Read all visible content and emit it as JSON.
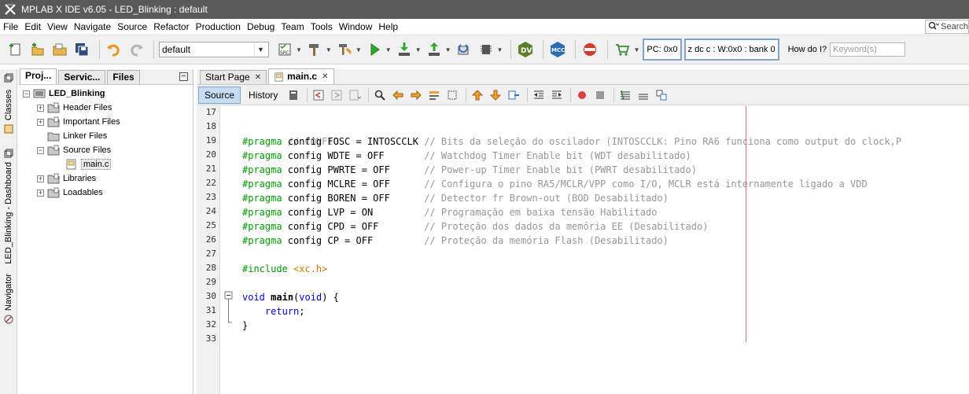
{
  "window": {
    "title": "MPLAB X IDE v6.05 - LED_Blinking : default"
  },
  "menu": [
    "File",
    "Edit",
    "View",
    "Navigate",
    "Source",
    "Refactor",
    "Production",
    "Debug",
    "Team",
    "Tools",
    "Window",
    "Help"
  ],
  "search": {
    "placeholder": "Search"
  },
  "toolbar": {
    "configuration": "default",
    "pc": "PC: 0x0",
    "status": "z dc c  : W:0x0 : bank 0",
    "howdoi_label": "How do I?",
    "keyword_placeholder": "Keyword(s)",
    "dv_label": "DV",
    "mcc_label": "MCC"
  },
  "left_strip": {
    "classes": "Classes",
    "dashboard": "LED_Blinking - Dashboard",
    "navigator": "Navigator"
  },
  "projects": {
    "tabs": [
      "Proj...",
      "Servic...",
      "Files"
    ],
    "root": "LED_Blinking",
    "folders": [
      "Header Files",
      "Important Files",
      "Linker Files",
      "Source Files",
      "Libraries",
      "Loadables"
    ],
    "source_file": "main.c"
  },
  "editor": {
    "tabs": [
      "Start Page",
      "main.c"
    ],
    "view_tabs": [
      "Source",
      "History"
    ],
    "line_numbers": [
      "17",
      "18",
      "19",
      "20",
      "21",
      "22",
      "23",
      "24",
      "25",
      "26",
      "27",
      "28",
      "29",
      "30",
      "31",
      "32",
      "33"
    ],
    "code": {
      "l18": "// CONFIG",
      "l19_pp": "#pragma",
      "l19_body": " config FOSC = INTOSCCLK ",
      "l19_comment": "// Bits da seleção do oscilador (INTOSCCLK: Pino RA6 funciona como output do clock,P",
      "l20_pp": "#pragma",
      "l20_body": " config WDTE = OFF       ",
      "l20_comment": "// Watchdog Timer Enable bit (WDT desabilitado)",
      "l21_pp": "#pragma",
      "l21_body": " config PWRTE = OFF      ",
      "l21_comment": "// Power-up Timer Enable bit (PWRT desabilitado)",
      "l22_pp": "#pragma",
      "l22_body": " config MCLRE = OFF      ",
      "l22_comment": "// Configura o pino RA5/MCLR/VPP como I/O, MCLR está internamente ligado a VDD",
      "l23_pp": "#pragma",
      "l23_body": " config BOREN = OFF      ",
      "l23_comment": "// Detector fr Brown-out (BOD Desabilitado)",
      "l24_pp": "#pragma",
      "l24_body": " config LVP = ON         ",
      "l24_comment": "// Programação em baixa tensão Habilitado",
      "l25_pp": "#pragma",
      "l25_body": " config CPD = OFF        ",
      "l25_comment": "// Proteção dos dados da memória EE (Desabilitado)",
      "l26_pp": "#pragma",
      "l26_body": " config CP = OFF         ",
      "l26_comment": "// Proteção da memória Flash (Desabilitado)",
      "l28_pp": "#include",
      "l28_header": "<xc.h>",
      "l30_kw1": "void",
      "l30_fn": "main",
      "l30_paren": "(",
      "l30_kw2": "void",
      "l30_end": ") {",
      "l31_kw": "return",
      "l31_end": ";",
      "l32": "}"
    }
  }
}
